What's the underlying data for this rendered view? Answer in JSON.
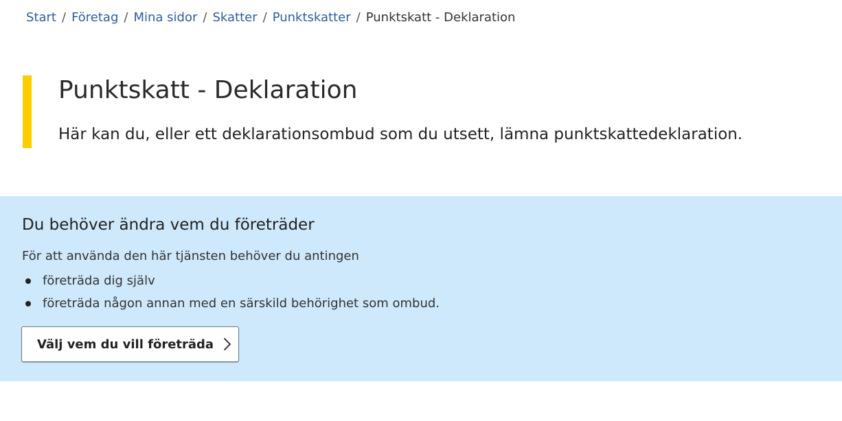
{
  "breadcrumb": {
    "items": [
      "Start",
      "Företag",
      "Mina sidor",
      "Skatter",
      "Punktskatter"
    ],
    "separator": "/",
    "current": "Punktskatt - Deklaration"
  },
  "hero": {
    "title": "Punktskatt - Deklaration",
    "lead": "Här kan du, eller ett deklarationsombud som du utsett, lämna punktskattedeklaration.",
    "accent_color": "#ffcc00"
  },
  "notice": {
    "background_color": "#cde9fb",
    "heading": "Du behöver ändra vem du företräder",
    "intro": "För att använda den här tjänsten behöver du antingen",
    "bullets": [
      "företräda dig själv",
      "företräda någon annan med en särskild behörighet som ombud."
    ],
    "button_label": "Välj vem du vill företräda",
    "button_icon": "chevron-right-icon"
  }
}
